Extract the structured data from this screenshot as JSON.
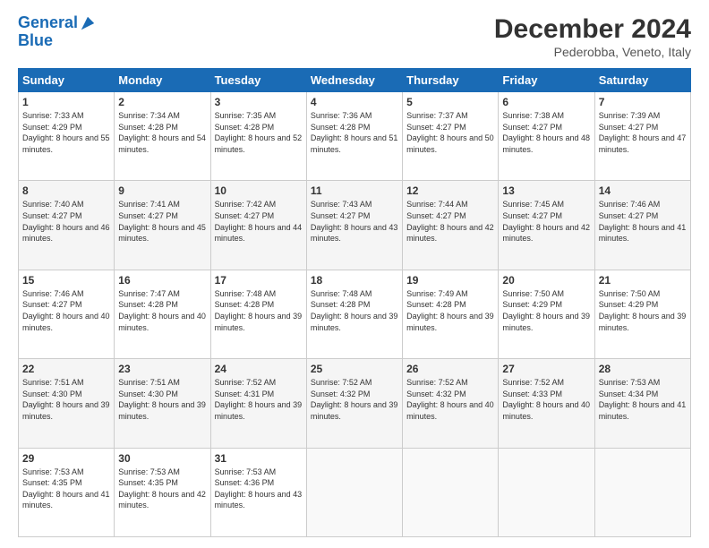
{
  "header": {
    "logo_line1": "General",
    "logo_line2": "Blue",
    "title": "December 2024",
    "location": "Pederobba, Veneto, Italy"
  },
  "weekdays": [
    "Sunday",
    "Monday",
    "Tuesday",
    "Wednesday",
    "Thursday",
    "Friday",
    "Saturday"
  ],
  "weeks": [
    [
      {
        "day": "1",
        "sunrise": "7:33 AM",
        "sunset": "4:29 PM",
        "daylight": "8 hours and 55 minutes."
      },
      {
        "day": "2",
        "sunrise": "7:34 AM",
        "sunset": "4:28 PM",
        "daylight": "8 hours and 54 minutes."
      },
      {
        "day": "3",
        "sunrise": "7:35 AM",
        "sunset": "4:28 PM",
        "daylight": "8 hours and 52 minutes."
      },
      {
        "day": "4",
        "sunrise": "7:36 AM",
        "sunset": "4:28 PM",
        "daylight": "8 hours and 51 minutes."
      },
      {
        "day": "5",
        "sunrise": "7:37 AM",
        "sunset": "4:27 PM",
        "daylight": "8 hours and 50 minutes."
      },
      {
        "day": "6",
        "sunrise": "7:38 AM",
        "sunset": "4:27 PM",
        "daylight": "8 hours and 48 minutes."
      },
      {
        "day": "7",
        "sunrise": "7:39 AM",
        "sunset": "4:27 PM",
        "daylight": "8 hours and 47 minutes."
      }
    ],
    [
      {
        "day": "8",
        "sunrise": "7:40 AM",
        "sunset": "4:27 PM",
        "daylight": "8 hours and 46 minutes."
      },
      {
        "day": "9",
        "sunrise": "7:41 AM",
        "sunset": "4:27 PM",
        "daylight": "8 hours and 45 minutes."
      },
      {
        "day": "10",
        "sunrise": "7:42 AM",
        "sunset": "4:27 PM",
        "daylight": "8 hours and 44 minutes."
      },
      {
        "day": "11",
        "sunrise": "7:43 AM",
        "sunset": "4:27 PM",
        "daylight": "8 hours and 43 minutes."
      },
      {
        "day": "12",
        "sunrise": "7:44 AM",
        "sunset": "4:27 PM",
        "daylight": "8 hours and 42 minutes."
      },
      {
        "day": "13",
        "sunrise": "7:45 AM",
        "sunset": "4:27 PM",
        "daylight": "8 hours and 42 minutes."
      },
      {
        "day": "14",
        "sunrise": "7:46 AM",
        "sunset": "4:27 PM",
        "daylight": "8 hours and 41 minutes."
      }
    ],
    [
      {
        "day": "15",
        "sunrise": "7:46 AM",
        "sunset": "4:27 PM",
        "daylight": "8 hours and 40 minutes."
      },
      {
        "day": "16",
        "sunrise": "7:47 AM",
        "sunset": "4:28 PM",
        "daylight": "8 hours and 40 minutes."
      },
      {
        "day": "17",
        "sunrise": "7:48 AM",
        "sunset": "4:28 PM",
        "daylight": "8 hours and 39 minutes."
      },
      {
        "day": "18",
        "sunrise": "7:48 AM",
        "sunset": "4:28 PM",
        "daylight": "8 hours and 39 minutes."
      },
      {
        "day": "19",
        "sunrise": "7:49 AM",
        "sunset": "4:28 PM",
        "daylight": "8 hours and 39 minutes."
      },
      {
        "day": "20",
        "sunrise": "7:50 AM",
        "sunset": "4:29 PM",
        "daylight": "8 hours and 39 minutes."
      },
      {
        "day": "21",
        "sunrise": "7:50 AM",
        "sunset": "4:29 PM",
        "daylight": "8 hours and 39 minutes."
      }
    ],
    [
      {
        "day": "22",
        "sunrise": "7:51 AM",
        "sunset": "4:30 PM",
        "daylight": "8 hours and 39 minutes."
      },
      {
        "day": "23",
        "sunrise": "7:51 AM",
        "sunset": "4:30 PM",
        "daylight": "8 hours and 39 minutes."
      },
      {
        "day": "24",
        "sunrise": "7:52 AM",
        "sunset": "4:31 PM",
        "daylight": "8 hours and 39 minutes."
      },
      {
        "day": "25",
        "sunrise": "7:52 AM",
        "sunset": "4:32 PM",
        "daylight": "8 hours and 39 minutes."
      },
      {
        "day": "26",
        "sunrise": "7:52 AM",
        "sunset": "4:32 PM",
        "daylight": "8 hours and 40 minutes."
      },
      {
        "day": "27",
        "sunrise": "7:52 AM",
        "sunset": "4:33 PM",
        "daylight": "8 hours and 40 minutes."
      },
      {
        "day": "28",
        "sunrise": "7:53 AM",
        "sunset": "4:34 PM",
        "daylight": "8 hours and 41 minutes."
      }
    ],
    [
      {
        "day": "29",
        "sunrise": "7:53 AM",
        "sunset": "4:35 PM",
        "daylight": "8 hours and 41 minutes."
      },
      {
        "day": "30",
        "sunrise": "7:53 AM",
        "sunset": "4:35 PM",
        "daylight": "8 hours and 42 minutes."
      },
      {
        "day": "31",
        "sunrise": "7:53 AM",
        "sunset": "4:36 PM",
        "daylight": "8 hours and 43 minutes."
      },
      null,
      null,
      null,
      null
    ]
  ]
}
